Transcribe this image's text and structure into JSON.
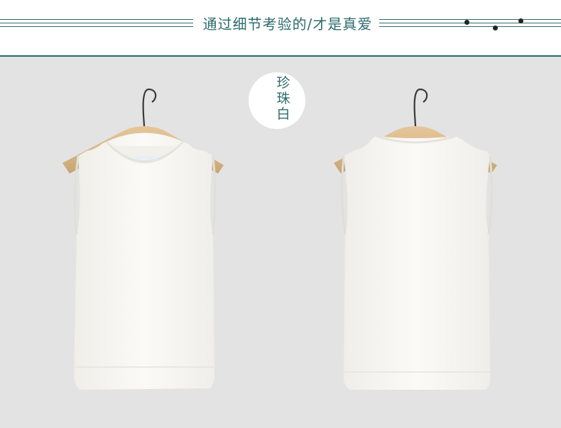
{
  "header": {
    "title": "通过细节考验的/才是真爱"
  },
  "badge": {
    "color_name": "珍珠白"
  },
  "colors": {
    "accent": "#2b6b6b",
    "background": "#e3e3e3",
    "garment": "#f7f6f3"
  }
}
